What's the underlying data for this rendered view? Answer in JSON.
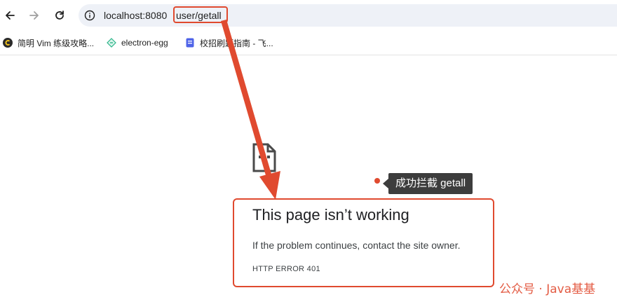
{
  "browser": {
    "url_host": "localhost:8080",
    "url_path": "user/getall",
    "bookmarks": [
      {
        "label": "简明 Vim 练级攻略...",
        "icon": "c-logo-icon"
      },
      {
        "label": "electron-egg",
        "icon": "egg-icon"
      },
      {
        "label": "校招刷题指南 - 飞...",
        "icon": "doc-icon"
      }
    ]
  },
  "error": {
    "title": "This page isn’t working",
    "message": "If the problem continues, contact the site owner.",
    "code": "HTTP ERROR 401"
  },
  "annotation": {
    "callout": "成功拦截 getall"
  },
  "watermark": "公众号 · Java基基",
  "colors": {
    "accent": "#e04a2f",
    "omnibox": "#eef1f7",
    "callout_bg": "#3d3d3d"
  }
}
